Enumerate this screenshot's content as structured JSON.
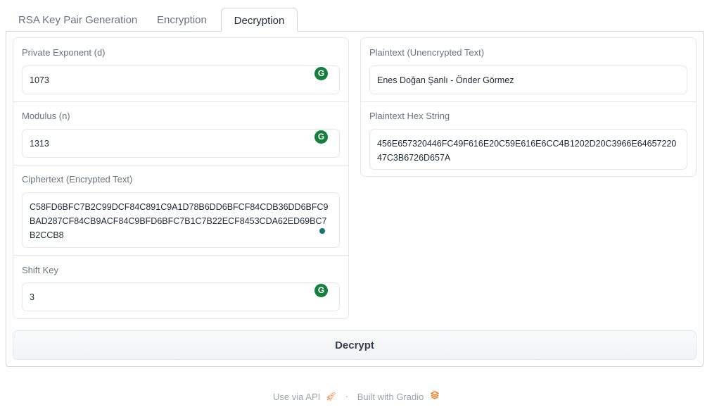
{
  "tabs": [
    {
      "label": "RSA Key Pair Generation"
    },
    {
      "label": "Encryption"
    },
    {
      "label": "Decryption",
      "active": true
    }
  ],
  "inputs": {
    "private_exponent": {
      "label": "Private Exponent (d)",
      "value": "1073"
    },
    "modulus": {
      "label": "Modulus (n)",
      "value": "1313"
    },
    "ciphertext": {
      "label": "Ciphertext (Encrypted Text)",
      "value": "C58FD6BFC7B2C99DCF84C891C9A1D78B6DD6BFCF84CDB36DD6BFC9BAD287CF84CB9ACF84C9BFD6BFC7B1C7B22ECF8453CDA62ED69BC7B2CCB8"
    },
    "shift_key": {
      "label": "Shift Key",
      "value": "3"
    }
  },
  "outputs": {
    "plaintext": {
      "label": "Plaintext (Unencrypted Text)",
      "value": "Enes Doğan Şanlı - Önder Görmez"
    },
    "plaintext_hex": {
      "label": "Plaintext Hex String",
      "value": "456E657320446FC49F616E20C59E616E6CC4B1202D20C3966E6465722047C3B6726D657A"
    }
  },
  "decrypt_button": {
    "label": "Decrypt"
  },
  "footer": {
    "api_link": "Use via API",
    "separator": "·",
    "built_with": "Built with Gradio"
  },
  "icons": {
    "grammarly": "grammarly-icon",
    "rocket": "rocket-icon",
    "gradio": "gradio-logo-icon"
  },
  "colors": {
    "accent": "#15803d",
    "rocket": "#f97316",
    "gradio": "#f97316"
  }
}
